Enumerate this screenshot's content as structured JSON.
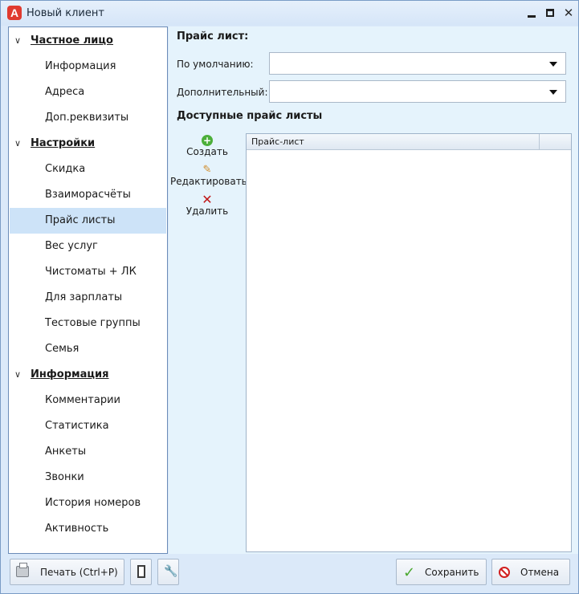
{
  "window": {
    "title": "Новый клиент"
  },
  "nav": {
    "groups": [
      {
        "label": "Частное лицо",
        "items": [
          "Информация",
          "Адреса",
          "Доп.реквизиты"
        ]
      },
      {
        "label": "Настройки",
        "items": [
          "Скидка",
          "Взаиморасчёты",
          "Прайс листы",
          "Вес услуг",
          "Чистоматы + ЛК",
          "Для зарплаты",
          "Тестовые группы",
          "Семья"
        ]
      },
      {
        "label": "Информация",
        "items": [
          "Комментарии",
          "Статистика",
          "Анкеты",
          "Звонки",
          "История номеров",
          "Активность"
        ]
      }
    ],
    "selected_item": "Прайс листы"
  },
  "panel": {
    "section_title": "Прайс лист:",
    "default_label": "По умолчанию:",
    "default_value": "",
    "additional_label": "Дополнительный:",
    "additional_value": "",
    "available_title": "Доступные прайс листы",
    "actions": {
      "create": "Создать",
      "edit": "Редактировать",
      "delete": "Удалить"
    },
    "grid": {
      "columns": [
        "Прайс-лист"
      ],
      "rows": []
    }
  },
  "footer": {
    "print_label": "Печать (Ctrl+P)",
    "save_label": "Сохранить",
    "cancel_label": "Отмена"
  },
  "colors": {
    "selected_bg": "#cde3f8",
    "panel_bg": "#e5f3fc",
    "accent_red": "#e03a2f"
  }
}
